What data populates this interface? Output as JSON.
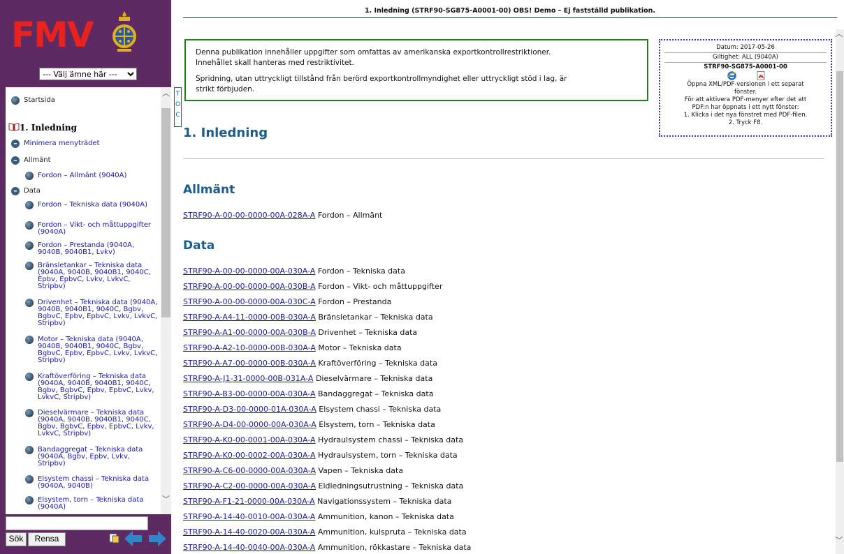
{
  "sidebar": {
    "logo_text": "FMV",
    "subject_select": "--- Välj ämne här ---",
    "toc_tab": "TOC",
    "nav": [
      {
        "label": "Startsida",
        "kind": "bullet"
      },
      {
        "label": "1. Inledning",
        "kind": "book"
      },
      {
        "label": "Minimera menyträdet",
        "kind": "minus"
      },
      {
        "label": "Allmänt",
        "kind": "minus"
      },
      {
        "label": "Fordon – Allmänt (9040A)",
        "kind": "bullet"
      },
      {
        "label": "Data",
        "kind": "minus"
      },
      {
        "label": "Fordon – Tekniska data (9040A)",
        "kind": "bullet"
      },
      {
        "label": "Fordon – Vikt- och måttuppgifter (9040A)",
        "kind": "bullet"
      },
      {
        "label": "Fordon – Prestanda (9040A, 9040B, 9040B1, Lvkv)",
        "kind": "bullet"
      },
      {
        "label": "Bränsletankar – Tekniska data (9040A, 9040B, 9040B1, 9040C, Epbv, EpbvC, Lvkv, LvkvC, Stripbv)",
        "kind": "bullet"
      },
      {
        "label": "Drivenhet – Tekniska data (9040A, 9040B, 9040B1, 9040C, Bgbv, BgbvC, Epbv, EpbvC, Lvkv, LvkvC, Stripbv)",
        "kind": "bullet"
      },
      {
        "label": "Motor – Tekniska data (9040A, 9040B, 9040B1, 9040C, Bgbv, BgbvC, Epbv, EpbvC, Lvkv, LvkvC, Stripbv)",
        "kind": "bullet"
      },
      {
        "label": "Kraftöverföring – Tekniska data (9040A, 9040B, 9040B1, 9040C, Bgbv, BgbvC, Epbv, EpbvC, Lvkv, LvkvC, Stripbv)",
        "kind": "bullet"
      },
      {
        "label": "Dieselvärmare – Tekniska data (9040A, 9040B, 9040B1, 9040C, Bgbv, BgbvC, Epbv, EpbvC, Lvkv, LvkvC, Stripbv)",
        "kind": "bullet"
      },
      {
        "label": "Bandaggregat – Tekniska data (9040A, Bgbv, Epbv, Lvkv, Stripbv)",
        "kind": "bullet"
      },
      {
        "label": "Elsystem chassi – Tekniska data (9040A, 9040B)",
        "kind": "bullet"
      },
      {
        "label": "Elsystem, torn – Tekniska data (9040A)",
        "kind": "bullet"
      }
    ],
    "search_button": "Sök",
    "clear_button": "Rensa"
  },
  "header": {
    "title": "1. Inledning (STRF90-SG875-A0001-00) OBS! Demo – Ej fastställd publikation."
  },
  "notice": {
    "p1_line1": "Denna publikation innehåller uppgifter som omfattas av amerikanska exportkontrollrestriktioner.",
    "p1_line2": "Innehållet skall hanteras med restriktivitet.",
    "p2_line1": "Spridning, utan uttryckligt tillstånd från berörd exportkontrollmyndighet eller uttryckligt stöd i lag, är",
    "p2_line2": "strikt förbjuden."
  },
  "info": {
    "date": "Datum: 2017-05-26",
    "validity": "Giltighet: ALL (9040A)",
    "doc_id": "STRF90-SG875-A0001-00",
    "open_line1": "Öppna XML/PDF-versionen i ett separat",
    "open_line2": "fönster.",
    "pdf_line1": "För att aktivera PDF-menyer efter det att",
    "pdf_line2": "PDF:n har öppnats i ett nytt fönster:",
    "step1": "1. Klicka i det nya fönstret med PDF-filen.",
    "step2": "2. Tryck F8."
  },
  "content": {
    "title": "1. Inledning",
    "sections": [
      {
        "heading": "Allmänt",
        "rows": [
          {
            "code": "STRF90-A-00-00-0000-00A-028A-A",
            "text": "Fordon – Allmänt"
          }
        ]
      },
      {
        "heading": "Data",
        "rows": [
          {
            "code": "STRF90-A-00-00-0000-00A-030A-A",
            "text": "Fordon – Tekniska data"
          },
          {
            "code": "STRF90-A-00-00-0000-00A-030B-A",
            "text": "Fordon – Vikt- och måttuppgifter"
          },
          {
            "code": "STRF90-A-00-00-0000-00A-030C-A",
            "text": "Fordon – Prestanda"
          },
          {
            "code": "STRF90-A-A4-11-0000-00B-030A-A",
            "text": "Bränsletankar – Tekniska data"
          },
          {
            "code": "STRF90-A-A1-00-0000-00A-030B-A",
            "text": "Drivenhet – Tekniska data"
          },
          {
            "code": "STRF90-A-A2-10-0000-00B-030A-A",
            "text": "Motor – Tekniska data"
          },
          {
            "code": "STRF90-A-A7-00-0000-00B-030A-A",
            "text": "Kraftöverföring – Tekniska data"
          },
          {
            "code": "STRF90-A-J1-31-0000-00B-031A-A",
            "text": "Dieselvärmare – Tekniska data"
          },
          {
            "code": "STRF90-A-B3-00-0000-00A-030A-A",
            "text": "Bandaggregat – Tekniska data"
          },
          {
            "code": "STRF90-A-D3-00-0000-01A-030A-A",
            "text": "Elsystem chassi – Tekniska data"
          },
          {
            "code": "STRF90-A-D4-00-0000-00A-030A-A",
            "text": "Elsystem, torn – Tekniska data"
          },
          {
            "code": "STRF90-A-K0-00-0001-00A-030A-A",
            "text": "Hydraulsystem chassi – Tekniska data"
          },
          {
            "code": "STRF90-A-K0-00-0002-00A-030A-A",
            "text": "Hydraulsystem, torn – Tekniska data"
          },
          {
            "code": "STRF90-A-C6-00-0000-00A-030A-A",
            "text": "Vapen – Tekniska data"
          },
          {
            "code": "STRF90-A-C2-00-0000-00A-030A-A",
            "text": "Eldledningsutrustning – Tekniska data"
          },
          {
            "code": "STRF90-A-F1-21-0000-00A-030A-A",
            "text": "Navigationssystem – Tekniska data"
          },
          {
            "code": "STRF90-A-14-40-0010-00A-030A-A",
            "text": "Ammunition, kanon – Tekniska data"
          },
          {
            "code": "STRF90-A-14-40-0020-00A-030A-A",
            "text": "Ammunition, kulspruta – Tekniska data"
          },
          {
            "code": "STRF90-A-14-40-0040-00A-030A-A",
            "text": "Ammunition, rökkastare – Tekniska data"
          }
        ]
      }
    ]
  },
  "colors": {
    "sidebar_bg": "#5e2a62",
    "logo_red": "#e8231f",
    "heading_blue": "#1d5b88",
    "link_blue": "#1a1a9c",
    "notice_border": "#2a7d1e",
    "info_border": "#3333cc"
  }
}
